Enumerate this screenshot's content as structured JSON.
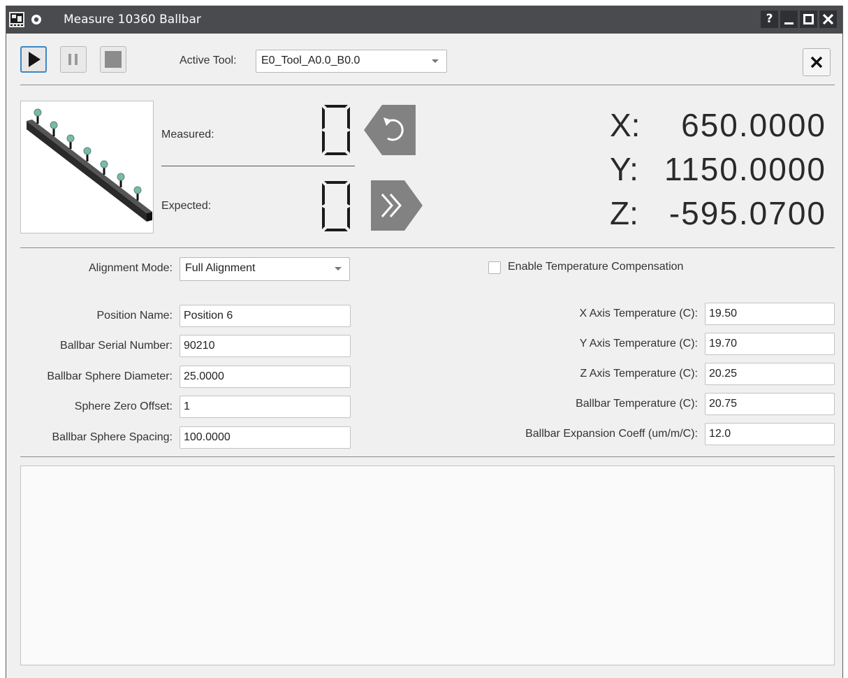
{
  "window": {
    "title": "Measure 10360 Ballbar",
    "help_label": "?",
    "icons": [
      "app-icon",
      "settings-icon",
      "minimize-icon",
      "maximize-icon",
      "close-icon"
    ]
  },
  "toolbar": {
    "play_icon": "play-icon",
    "pause_icon": "pause-icon",
    "stop_icon": "stop-icon",
    "active_tool_label": "Active Tool:",
    "active_tool_value": "E0_Tool_A0.0_B0.0",
    "close_icon": "close-icon"
  },
  "counter": {
    "measured_label": "Measured:",
    "measured_value": "0",
    "expected_label": "Expected:",
    "expected_value": "0",
    "reset_icon": "rewind-reset-icon",
    "advance_icon": "fast-forward-icon"
  },
  "position": {
    "x_label": "X:",
    "x_value": "650.0000",
    "y_label": "Y:",
    "y_value": "1150.0000",
    "z_label": "Z:",
    "z_value": "-595.0700"
  },
  "settings": {
    "alignment_mode_label": "Alignment Mode:",
    "alignment_mode_value": "Full Alignment",
    "temp_comp_label": "Enable Temperature Compensation",
    "temp_comp_checked": false,
    "position_name_label": "Position Name:",
    "position_name_value": "Position 6",
    "serial_label": "Ballbar Serial Number:",
    "serial_value": "90210",
    "diameter_label": "Ballbar Sphere Diameter:",
    "diameter_value": "25.0000",
    "zero_offset_label": "Sphere Zero Offset:",
    "zero_offset_value": "1",
    "spacing_label": "Ballbar Sphere Spacing:",
    "spacing_value": "100.0000",
    "x_temp_label": "X Axis Temperature (C):",
    "x_temp_value": "19.50",
    "y_temp_label": "Y Axis Temperature (C):",
    "y_temp_value": "19.70",
    "z_temp_label": "Z Axis Temperature (C):",
    "z_temp_value": "20.25",
    "ballbar_temp_label": "Ballbar Temperature (C):",
    "ballbar_temp_value": "20.75",
    "expansion_label": "Ballbar Expansion Coeff (um/m/C):",
    "expansion_value": "12.0"
  },
  "log": {
    "text": ""
  }
}
